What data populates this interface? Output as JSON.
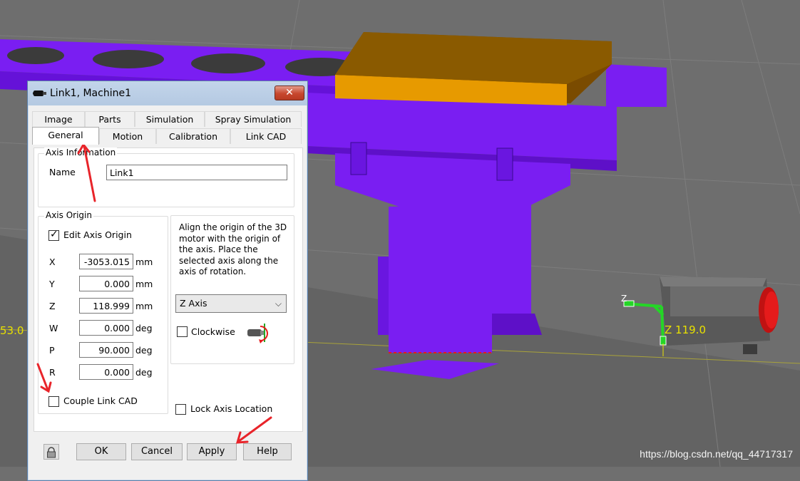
{
  "window": {
    "title": "Link1, Machine1",
    "close_glyph": "✕"
  },
  "tabs_row1": [
    {
      "label": "Image"
    },
    {
      "label": "Parts"
    },
    {
      "label": "Simulation"
    },
    {
      "label": "Spray Simulation"
    }
  ],
  "tabs_row2": [
    {
      "label": "General",
      "active": true
    },
    {
      "label": "Motion"
    },
    {
      "label": "Calibration"
    },
    {
      "label": "Link CAD"
    }
  ],
  "axis_information": {
    "title": "Axis Information",
    "name_label": "Name",
    "name_value": "Link1"
  },
  "axis_origin": {
    "title": "Axis Origin",
    "edit_label": "Edit Axis Origin",
    "edit_checked": true,
    "fields": [
      {
        "label": "X",
        "value": "-3053.015",
        "unit": "mm"
      },
      {
        "label": "Y",
        "value": "0.000",
        "unit": "mm"
      },
      {
        "label": "Z",
        "value": "118.999",
        "unit": "mm"
      },
      {
        "label": "W",
        "value": "0.000",
        "unit": "deg"
      },
      {
        "label": "P",
        "value": "90.000",
        "unit": "deg"
      },
      {
        "label": "R",
        "value": "0.000",
        "unit": "deg"
      }
    ],
    "couple_label": "Couple Link CAD",
    "couple_checked": false
  },
  "align_hint": "Align the origin of the 3D motor with the origin of the axis.  Place the selected axis along the axis of rotation.",
  "axis_select": {
    "value": "Z Axis"
  },
  "clockwise": {
    "label": "Clockwise",
    "checked": false
  },
  "lock_axis": {
    "label": "Lock Axis Location",
    "checked": false
  },
  "buttons": {
    "ok": "OK",
    "cancel": "Cancel",
    "apply": "Apply",
    "help": "Help"
  },
  "viewport": {
    "left_value": "53.0",
    "axis_letter": "Z",
    "axis_readout": "Z 119.0",
    "watermark": "https://blog.csdn.net/qq_44717317"
  },
  "colors": {
    "link_purple": "#7a1ef2",
    "plate_orange": "#e79a00",
    "motor_red": "#e51b1b",
    "annotation_red": "#e8242a"
  }
}
